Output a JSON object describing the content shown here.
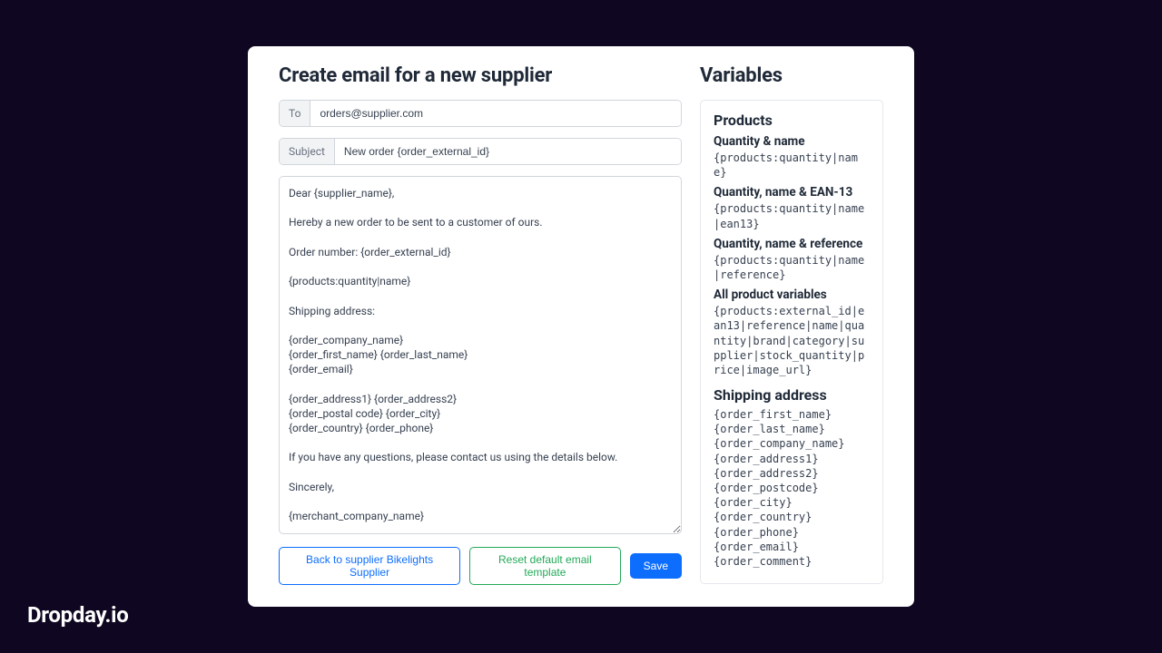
{
  "brand": "Dropday.io",
  "header": {
    "title": "Create email for a new supplier"
  },
  "form": {
    "to_label": "To",
    "to_value": "orders@supplier.com",
    "subject_label": "Subject",
    "subject_value": "New order {order_external_id}",
    "body": "Dear {supplier_name},\n\nHereby a new order to be sent to a customer of ours.\n\nOrder number: {order_external_id}\n\n{products:quantity|name}\n\nShipping address:\n\n{order_company_name}\n{order_first_name} {order_last_name}\n{order_email}\n\n{order_address1} {order_address2}\n{order_postal code} {order_city}\n{order_country} {order_phone}\n\nIf you have any questions, please contact us using the details below.\n\nSincerely,\n\n{merchant_company_name}"
  },
  "actions": {
    "back": "Back to supplier Bikelights Supplier",
    "reset": "Reset default email template",
    "save": "Save"
  },
  "variables": {
    "title": "Variables",
    "products_heading": "Products",
    "items": [
      {
        "label": "Quantity & name",
        "code": "{products:quantity|name}"
      },
      {
        "label": "Quantity, name & EAN-13",
        "code": "{products:quantity|name|ean13}"
      },
      {
        "label": "Quantity, name & reference",
        "code": "{products:quantity|name|reference}"
      },
      {
        "label": "All product variables",
        "code": "{products:external_id|ean13|reference|name|quantity|brand|category|supplier|stock_quantity|price|image_url}"
      }
    ],
    "shipping_heading": "Shipping address",
    "shipping_vars": [
      "{order_first_name}",
      "{order_last_name}",
      "{order_company_name}",
      "{order_address1}",
      "{order_address2}",
      "{order_postcode}",
      "{order_city}",
      "{order_country}",
      "{order_phone}",
      "{order_email}",
      "{order_comment}"
    ]
  }
}
